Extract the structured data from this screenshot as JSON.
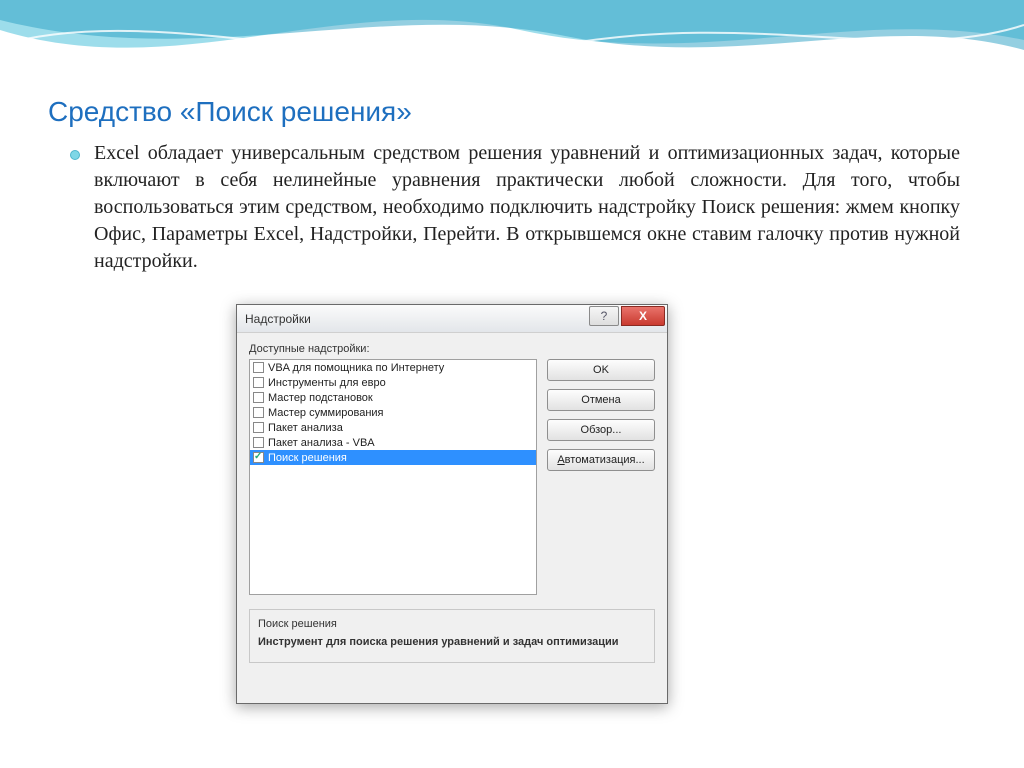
{
  "slide": {
    "title": "Средство «Поиск решения»",
    "body": "Excel обладает универсальным средством решения уравнений и оптимизационных задач, которые включают в себя нелинейные уравнения практически любой сложности. Для того, чтобы воспользоваться этим средством, необходимо подключить надстройку Поиск решения: жмем кнопку Офис, Параметры Excel, Надстройки, Перейти. В открывшемся окне ставим галочку против нужной надстройки."
  },
  "dialog": {
    "title": "Надстройки",
    "available_label": "Доступные надстройки:",
    "items": [
      {
        "label": "VBA для помощника по Интернету",
        "checked": false,
        "selected": false
      },
      {
        "label": "Инструменты для евро",
        "checked": false,
        "selected": false
      },
      {
        "label": "Мастер подстановок",
        "checked": false,
        "selected": false
      },
      {
        "label": "Мастер суммирования",
        "checked": false,
        "selected": false
      },
      {
        "label": "Пакет анализа",
        "checked": false,
        "selected": false
      },
      {
        "label": "Пакет анализа - VBA",
        "checked": false,
        "selected": false
      },
      {
        "label": "Поиск решения",
        "checked": true,
        "selected": true
      }
    ],
    "buttons": {
      "ok": "OK",
      "cancel": "Отмена",
      "browse": "Обзор...",
      "automation_prefix": "А",
      "automation_rest": "втоматизация..."
    },
    "description": {
      "heading": "Поиск решения",
      "text": "Инструмент для поиска решения уравнений и задач оптимизации"
    },
    "close_glyph": "X",
    "help_glyph": "?"
  }
}
